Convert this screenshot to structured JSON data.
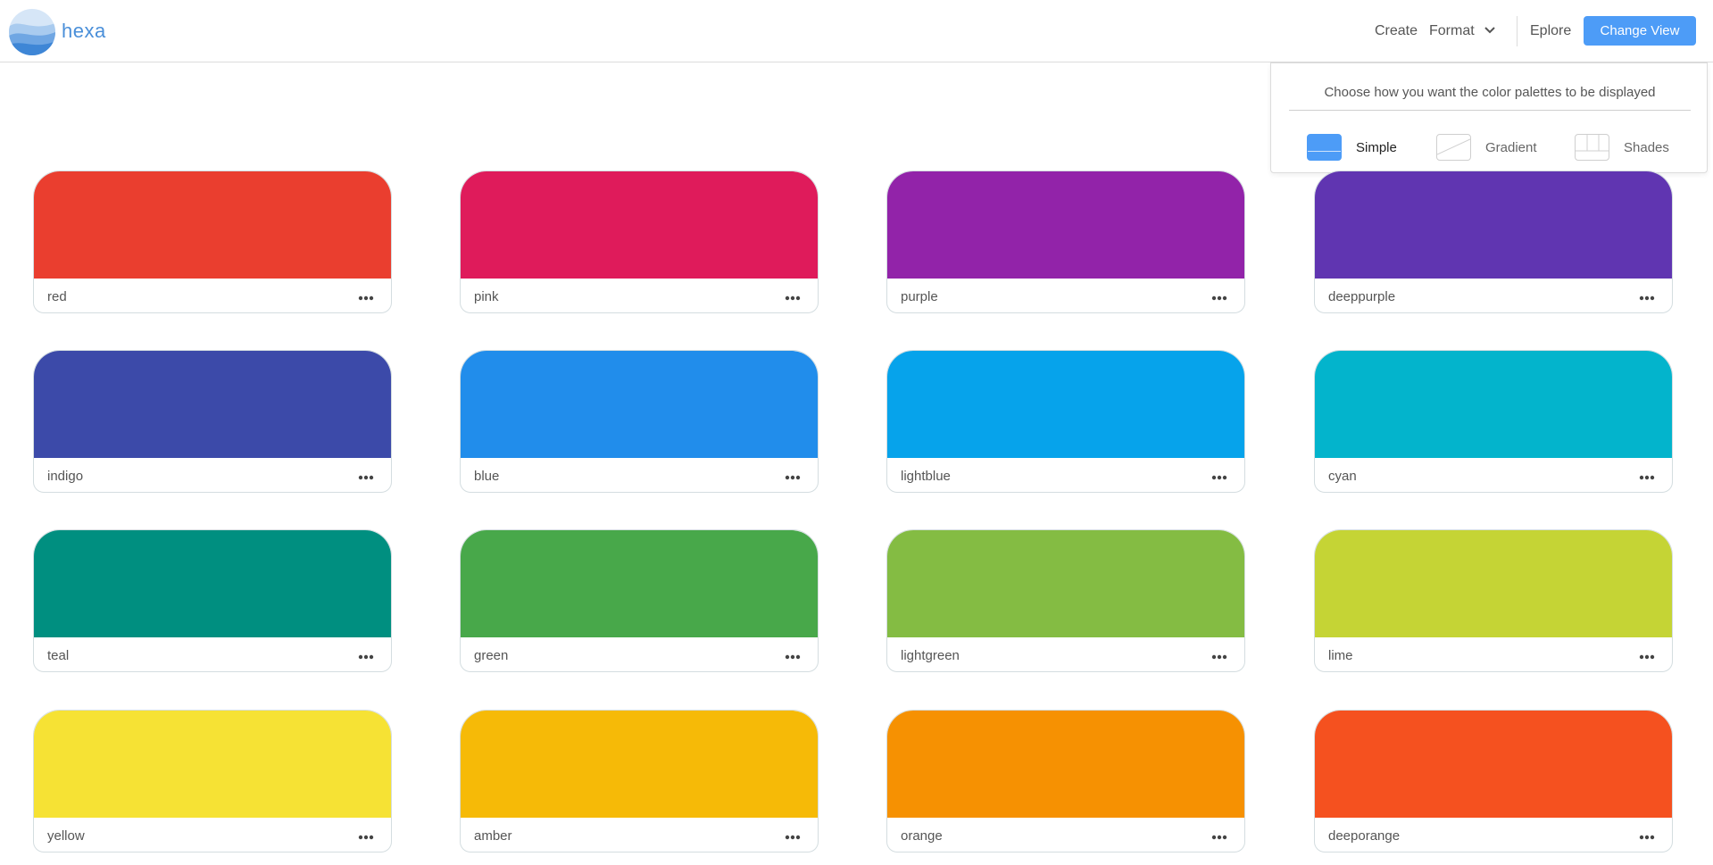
{
  "brand": {
    "name": "hexa"
  },
  "nav": {
    "create": "Create",
    "format": "Format",
    "explore": "Eplore",
    "change_view": "Change View"
  },
  "view_popover": {
    "title": "Choose how you want the color palettes to be displayed",
    "options": [
      {
        "label": "Simple",
        "selected": true,
        "icon": "simple-view-icon"
      },
      {
        "label": "Gradient",
        "selected": false,
        "icon": "gradient-view-icon"
      },
      {
        "label": "Shades",
        "selected": false,
        "icon": "shades-view-icon"
      }
    ]
  },
  "palettes": [
    {
      "name": "red",
      "color": "#ea3e2f"
    },
    {
      "name": "pink",
      "color": "#df1b5b"
    },
    {
      "name": "purple",
      "color": "#9223a9"
    },
    {
      "name": "deeppurple",
      "color": "#6035b1"
    },
    {
      "name": "indigo",
      "color": "#3c4aa9"
    },
    {
      "name": "blue",
      "color": "#218deb"
    },
    {
      "name": "lightblue",
      "color": "#06a3eb"
    },
    {
      "name": "cyan",
      "color": "#03b4cc"
    },
    {
      "name": "teal",
      "color": "#008f80"
    },
    {
      "name": "green",
      "color": "#48a84a"
    },
    {
      "name": "lightgreen",
      "color": "#84bc43"
    },
    {
      "name": "lime",
      "color": "#c5d435"
    },
    {
      "name": "yellow",
      "color": "#f6e234"
    },
    {
      "name": "amber",
      "color": "#f6ba07"
    },
    {
      "name": "orange",
      "color": "#f69102"
    },
    {
      "name": "deeporange",
      "color": "#f5511f"
    }
  ],
  "colors": {
    "accent": "#4d9cf7",
    "logo": "#4a8fd9",
    "border": "#d4dde0"
  },
  "icons": {
    "more": "more-horizontal-icon",
    "chevron": "chevron-down-icon"
  }
}
